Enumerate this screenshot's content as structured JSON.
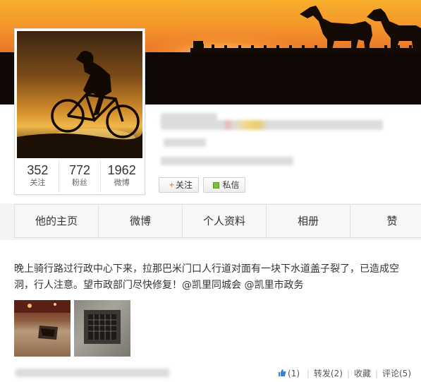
{
  "profile": {
    "stats": [
      {
        "value": "352",
        "label": "关注"
      },
      {
        "value": "772",
        "label": "粉丝"
      },
      {
        "value": "1962",
        "label": "微博"
      }
    ],
    "follow_button": "关注",
    "follow_icon": "+",
    "message_button": "私信"
  },
  "tabs": [
    {
      "label": "他的主页"
    },
    {
      "label": "微博"
    },
    {
      "label": "个人资料"
    },
    {
      "label": "相册"
    },
    {
      "label": "赞"
    }
  ],
  "post": {
    "text": "晚上骑行路过行政中心下来，拉那巴米门口人行道对面有一块下水道盖子裂了，已造成空洞，行人注意。望市政部门尽快修复！",
    "mentions": [
      "@凯里同城会",
      "@凯里市政务"
    ],
    "actions": {
      "like": "(1)",
      "repost": "转发(2)",
      "favorite": "收藏",
      "comment": "评论(5)"
    }
  },
  "colors": {
    "accent_orange": "#f29b1a",
    "message_green": "#7cc240",
    "like_blue": "#3a7fd5"
  }
}
